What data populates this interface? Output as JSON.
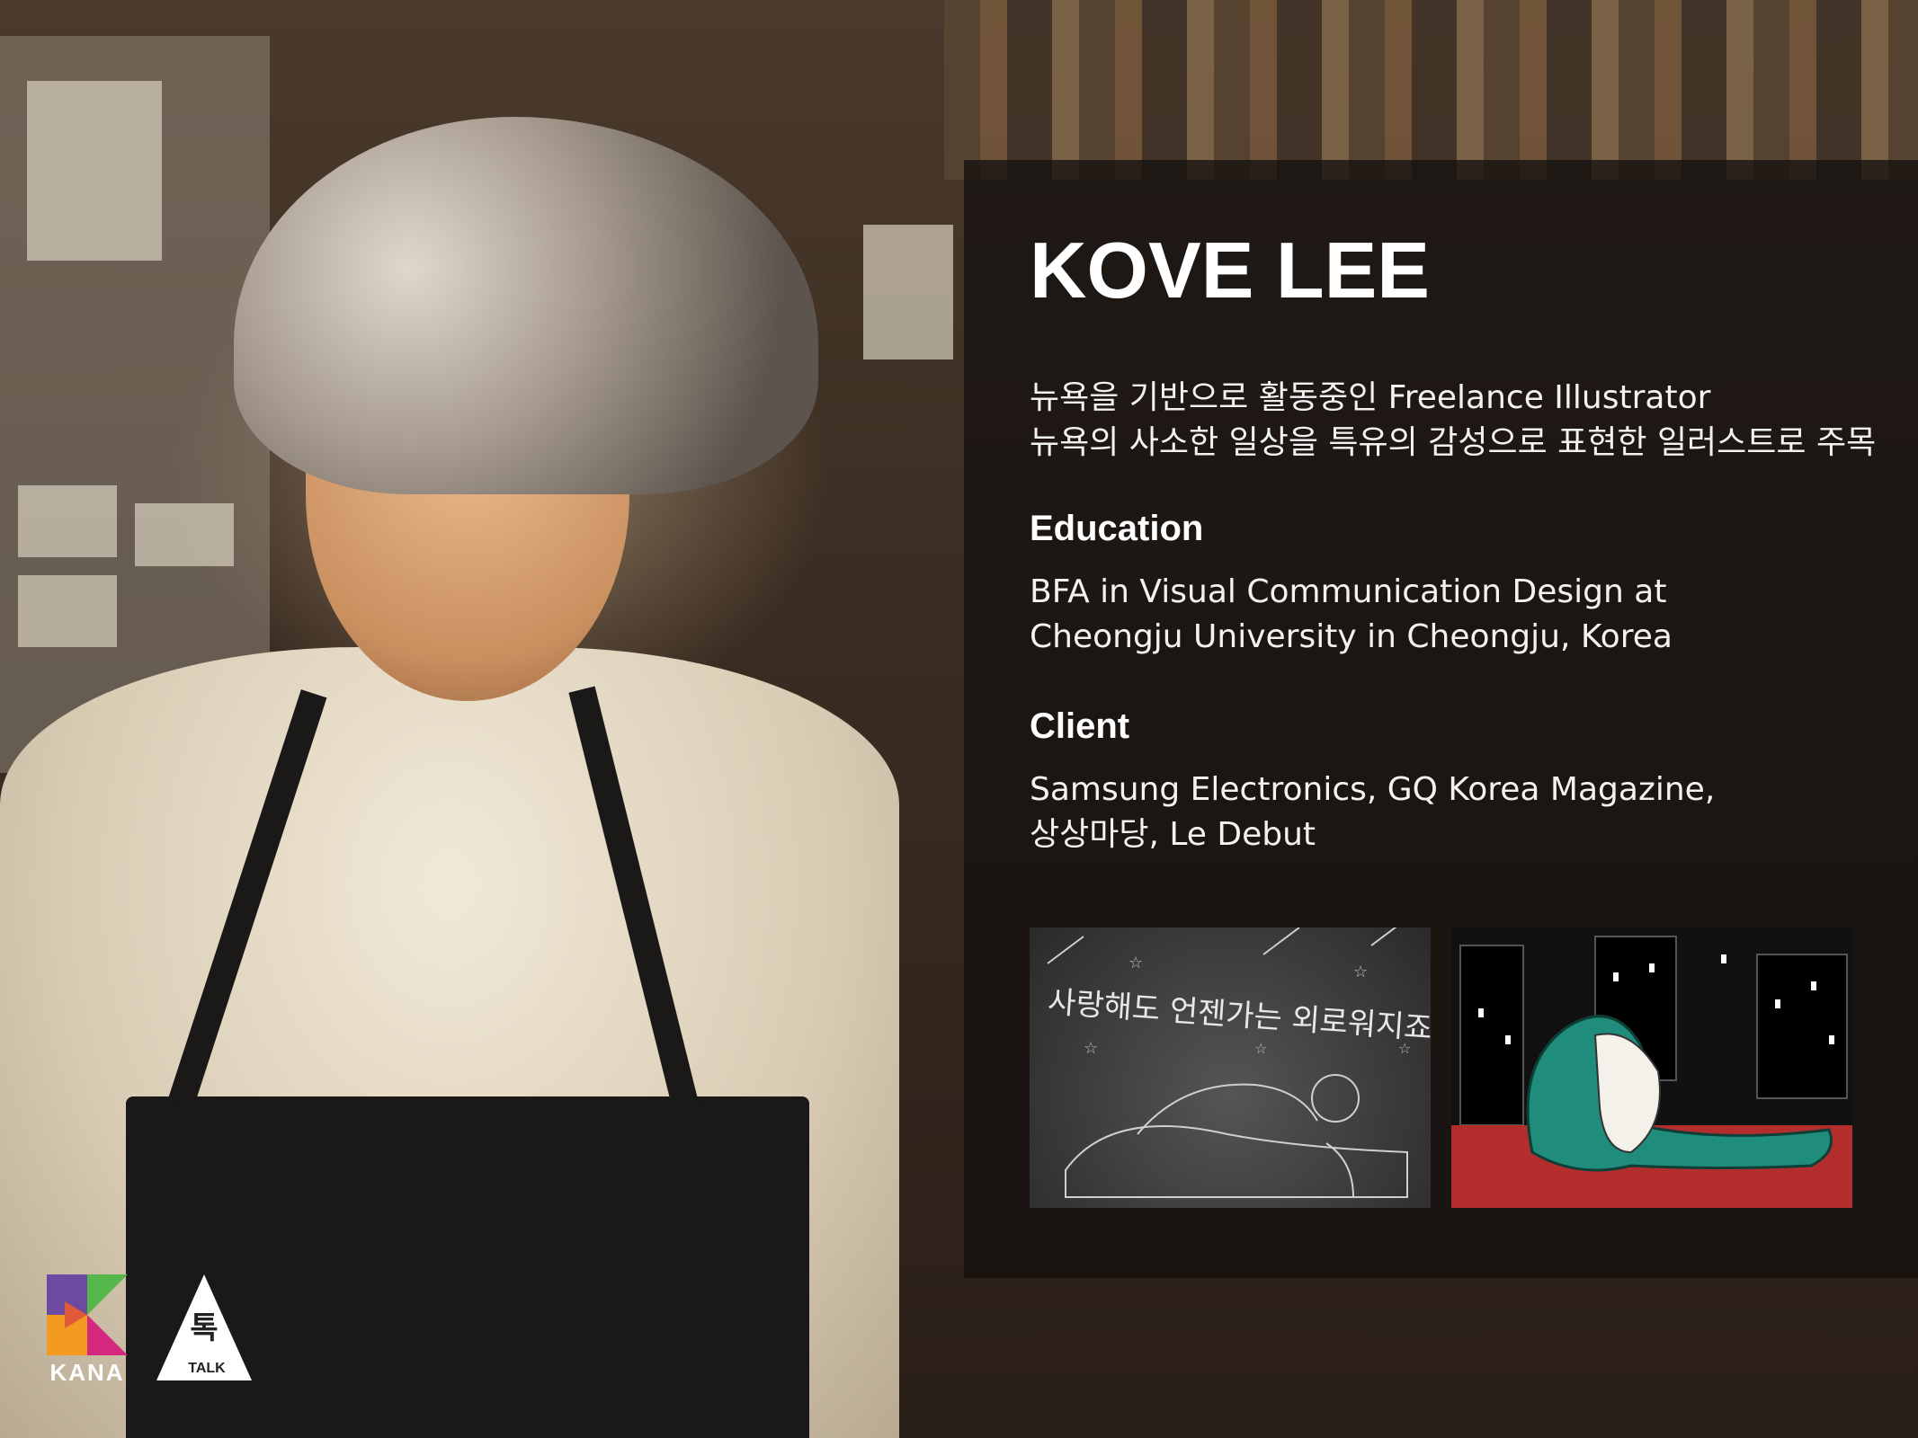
{
  "profile": {
    "name": "KOVE LEE",
    "intro": [
      "뉴욕을 기반으로 활동중인 Freelance Illustrator",
      "뉴욕의 사소한 일상을 특유의 감성으로 표현한 일러스트로 주목"
    ],
    "education": {
      "heading": "Education",
      "lines": [
        "BFA in Visual Communication Design at",
        "Cheongju University in Cheongju, Korea"
      ]
    },
    "client": {
      "heading": "Client",
      "lines": [
        "Samsung Electronics, GQ Korea Magazine,",
        "상상마당, Le Debut"
      ]
    },
    "artworks": [
      {
        "caption": "사랑해도 언젠가는 외로워지죠",
        "icon": "illustration-bathtub"
      },
      {
        "icon": "illustration-embrace-city-night"
      }
    ]
  },
  "branding": {
    "kana_label": "KANA",
    "talk_glyph": "톡",
    "talk_label": "TALK",
    "colors": {
      "kana_green": "#56b84a",
      "kana_magenta": "#d6277f",
      "kana_orange": "#f39a21",
      "kana_purple": "#6b4aa0",
      "art_teal": "#1f8c7c",
      "art_red": "#b42d2d"
    }
  }
}
